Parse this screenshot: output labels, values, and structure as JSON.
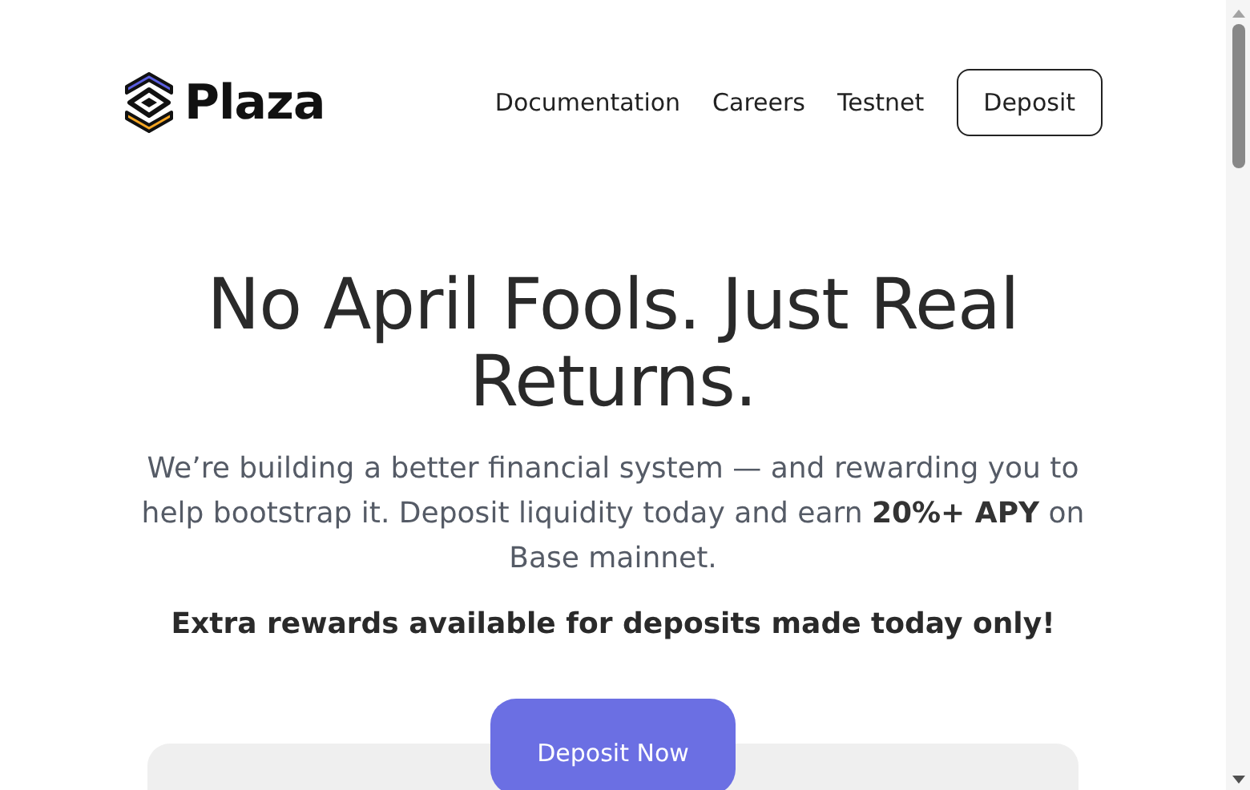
{
  "header": {
    "brand": "Plaza",
    "nav_links": [
      "Documentation",
      "Careers",
      "Testnet"
    ],
    "cta": "Deposit"
  },
  "hero": {
    "title": "No April Fools. Just Real Returns.",
    "text": "We’re building a better financial system — and rewarding you to help bootstrap it. Deposit liquidity today and earn **20%+ APY** on Base mainnet.",
    "note": "Extra rewards available for deposits made today only!",
    "button": "Deposit Now"
  }
}
